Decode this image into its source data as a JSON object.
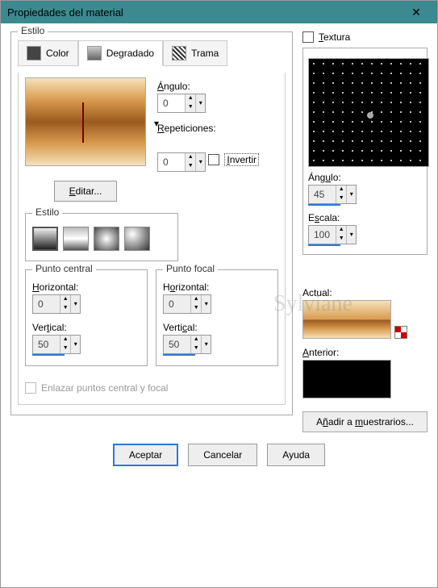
{
  "window": {
    "title": "Propiedades del material",
    "close": "✕"
  },
  "estilo": {
    "legend": "Estilo",
    "tab_color": "Color",
    "tab_degradado": "Degradado",
    "tab_trama": "Trama"
  },
  "degradado": {
    "angulo_label": "Ángulo:",
    "angulo_value": "0",
    "repeticiones_label": "Repeticiones:",
    "repeticiones_value": "0",
    "editar": "Editar...",
    "invertir": "Invertir",
    "estilo_legend": "Estilo"
  },
  "punto_central": {
    "legend": "Punto central",
    "horizontal_label": "Horizontal:",
    "horizontal_value": "0",
    "vertical_label": "Vertical:",
    "vertical_value": "50"
  },
  "punto_focal": {
    "legend": "Punto focal",
    "horizontal_label": "Horizontal:",
    "horizontal_value": "0",
    "vertical_label": "Vertical:",
    "vertical_value": "50"
  },
  "enlazar": {
    "label": "Enlazar puntos central y focal"
  },
  "textura": {
    "label": "Textura",
    "angulo_label": "Ángulo:",
    "angulo_value": "45",
    "escala_label": "Escala:",
    "escala_value": "100"
  },
  "preview": {
    "actual_label": "Actual:",
    "anterior_label": "Anterior:"
  },
  "anadir": "Añadir a muestrarios...",
  "footer": {
    "aceptar": "Aceptar",
    "cancelar": "Cancelar",
    "ayuda": "Ayuda"
  },
  "watermark": "Sylviane",
  "arrow_up": "▲",
  "arrow_down": "▼",
  "caret": "▾"
}
